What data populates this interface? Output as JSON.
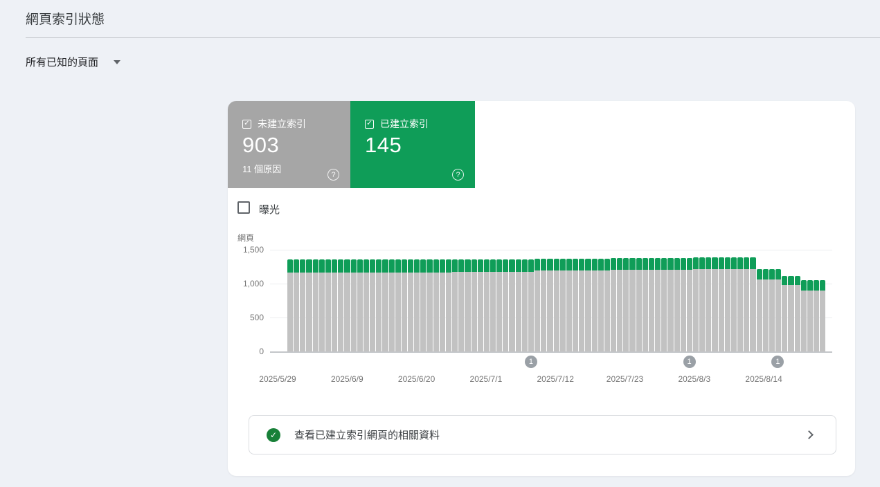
{
  "header": {
    "title": "網頁索引狀態"
  },
  "filter": {
    "label": "所有已知的頁面"
  },
  "icons": {
    "checkbox_checked": "✓",
    "help": "?",
    "success_check": "✓"
  },
  "tiles": {
    "not_indexed": {
      "label": "未建立索引",
      "value": "903",
      "reasons": "11 個原因",
      "checked": true,
      "color": "#a6a6a6"
    },
    "indexed": {
      "label": "已建立索引",
      "value": "145",
      "checked": true,
      "color": "#0f9d58"
    }
  },
  "impressions_toggle": {
    "label": "曝光",
    "checked": false
  },
  "chart_data": {
    "type": "bar",
    "stacked": true,
    "ylabel": "網頁",
    "ylim": [
      0,
      1500
    ],
    "grid": true,
    "ytick_labels": [
      "1,500",
      "1,000",
      "500",
      "0"
    ],
    "xtick_labels": [
      "2025/5/29",
      "2025/6/9",
      "2025/6/20",
      "2025/7/1",
      "2025/7/12",
      "2025/7/23",
      "2025/8/3",
      "2025/8/14"
    ],
    "dates": [
      "2025/5/29",
      "2025/5/30",
      "2025/5/31",
      "2025/6/1",
      "2025/6/2",
      "2025/6/3",
      "2025/6/4",
      "2025/6/5",
      "2025/6/6",
      "2025/6/7",
      "2025/6/8",
      "2025/6/9",
      "2025/6/10",
      "2025/6/11",
      "2025/6/12",
      "2025/6/13",
      "2025/6/14",
      "2025/6/15",
      "2025/6/16",
      "2025/6/17",
      "2025/6/18",
      "2025/6/19",
      "2025/6/20",
      "2025/6/21",
      "2025/6/22",
      "2025/6/23",
      "2025/6/24",
      "2025/6/25",
      "2025/6/26",
      "2025/6/27",
      "2025/6/28",
      "2025/6/29",
      "2025/6/30",
      "2025/7/1",
      "2025/7/2",
      "2025/7/3",
      "2025/7/4",
      "2025/7/5",
      "2025/7/6",
      "2025/7/7",
      "2025/7/8",
      "2025/7/9",
      "2025/7/10",
      "2025/7/11",
      "2025/7/12",
      "2025/7/13",
      "2025/7/14",
      "2025/7/15",
      "2025/7/16",
      "2025/7/17",
      "2025/7/18",
      "2025/7/19",
      "2025/7/20",
      "2025/7/21",
      "2025/7/22",
      "2025/7/23",
      "2025/7/24",
      "2025/7/25",
      "2025/7/26",
      "2025/7/27",
      "2025/7/28",
      "2025/7/29",
      "2025/7/30",
      "2025/7/31",
      "2025/8/1",
      "2025/8/2",
      "2025/8/3",
      "2025/8/4",
      "2025/8/5",
      "2025/8/6",
      "2025/8/7",
      "2025/8/8",
      "2025/8/9",
      "2025/8/10",
      "2025/8/11",
      "2025/8/12",
      "2025/8/13",
      "2025/8/14",
      "2025/8/15",
      "2025/8/16",
      "2025/8/17",
      "2025/8/18",
      "2025/8/19",
      "2025/8/20",
      "2025/8/21"
    ],
    "series": [
      {
        "name": "未建立索引",
        "color": "#c2c2c2",
        "values": [
          1160,
          1160,
          1160,
          1160,
          1160,
          1160,
          1160,
          1160,
          1160,
          1160,
          1160,
          1160,
          1167,
          1167,
          1167,
          1167,
          1167,
          1167,
          1167,
          1167,
          1167,
          1167,
          1167,
          1167,
          1167,
          1167,
          1177,
          1177,
          1177,
          1177,
          1177,
          1177,
          1177,
          1177,
          1177,
          1177,
          1177,
          1177,
          1177,
          1190,
          1190,
          1190,
          1190,
          1190,
          1190,
          1190,
          1190,
          1190,
          1190,
          1190,
          1190,
          1203,
          1203,
          1203,
          1203,
          1203,
          1203,
          1203,
          1203,
          1203,
          1203,
          1203,
          1203,
          1203,
          1212,
          1212,
          1212,
          1212,
          1212,
          1212,
          1212,
          1212,
          1212,
          1212,
          1062,
          1062,
          1062,
          1062,
          980,
          980,
          980,
          903,
          903,
          903,
          903
        ]
      },
      {
        "name": "已建立索引",
        "color": "#0f9d58",
        "values": [
          196,
          196,
          196,
          196,
          196,
          196,
          196,
          196,
          196,
          196,
          196,
          196,
          190,
          190,
          190,
          190,
          190,
          190,
          190,
          190,
          190,
          190,
          190,
          190,
          190,
          190,
          186,
          186,
          186,
          186,
          186,
          186,
          186,
          186,
          186,
          186,
          186,
          186,
          186,
          183,
          183,
          183,
          183,
          183,
          183,
          183,
          183,
          183,
          183,
          183,
          183,
          180,
          180,
          180,
          180,
          180,
          180,
          180,
          180,
          180,
          180,
          180,
          180,
          180,
          174,
          174,
          174,
          174,
          174,
          174,
          174,
          174,
          174,
          174,
          152,
          152,
          152,
          152,
          136,
          136,
          136,
          145,
          145,
          145,
          145
        ]
      }
    ],
    "annotations": [
      {
        "index": 38,
        "date": "2025/7/6",
        "label": "1"
      },
      {
        "index": 63,
        "date": "2025/7/31",
        "label": "1"
      },
      {
        "index": 77,
        "date": "2025/8/14",
        "label": "1"
      }
    ]
  },
  "footer_link": {
    "label": "查看已建立索引網頁的相關資料"
  },
  "colors": {
    "accent_green": "#0f9d58",
    "tile_gray": "#a6a6a6",
    "bar_gray": "#c2c2c2",
    "success_green": "#188038",
    "page_background": "#eef1f6"
  }
}
